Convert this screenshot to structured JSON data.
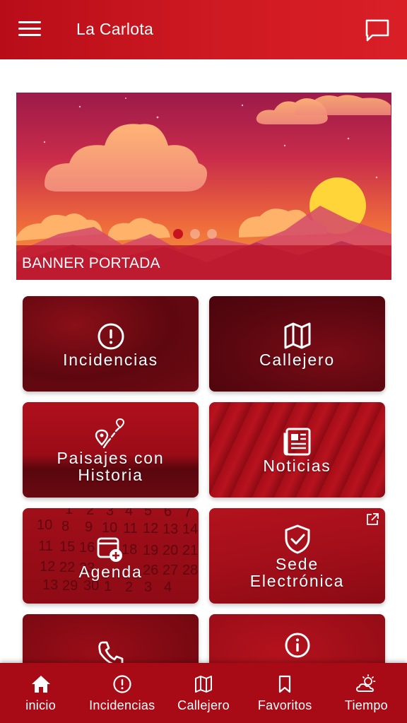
{
  "app": {
    "title": "La Carlota"
  },
  "banner": {
    "caption": "BANNER PORTADA",
    "slide_count": 3,
    "active_slide": 1
  },
  "tiles": [
    {
      "label_lines": [
        "Incidencias"
      ],
      "icon": "alert-circle-icon"
    },
    {
      "label_lines": [
        "Callejero"
      ],
      "icon": "map-icon"
    },
    {
      "label_lines": [
        "Paisajes con",
        "Historia"
      ],
      "icon": "route-pins-icon"
    },
    {
      "label_lines": [
        "Noticias"
      ],
      "icon": "newspaper-icon"
    },
    {
      "label_lines": [
        "Agenda"
      ],
      "icon": "calendar-add-icon"
    },
    {
      "label_lines": [
        "Sede",
        "Electrónica"
      ],
      "icon": "shield-check-icon",
      "external": true
    },
    {
      "label_lines": [
        ""
      ],
      "icon": "phone-icon"
    },
    {
      "label_lines": [
        ""
      ],
      "icon": "info-icon"
    }
  ],
  "bottom_nav": [
    {
      "label": "inicio",
      "icon": "home-icon",
      "active": true
    },
    {
      "label": "Incidencias",
      "icon": "alert-circle-icon"
    },
    {
      "label": "Callejero",
      "icon": "map-icon"
    },
    {
      "label": "Favoritos",
      "icon": "bookmark-icon"
    },
    {
      "label": "Tiempo",
      "icon": "weather-icon"
    }
  ],
  "colors": {
    "primary": "#c8121e",
    "nav_background": "#a80b16",
    "banner_sun": "#ffd53a"
  }
}
